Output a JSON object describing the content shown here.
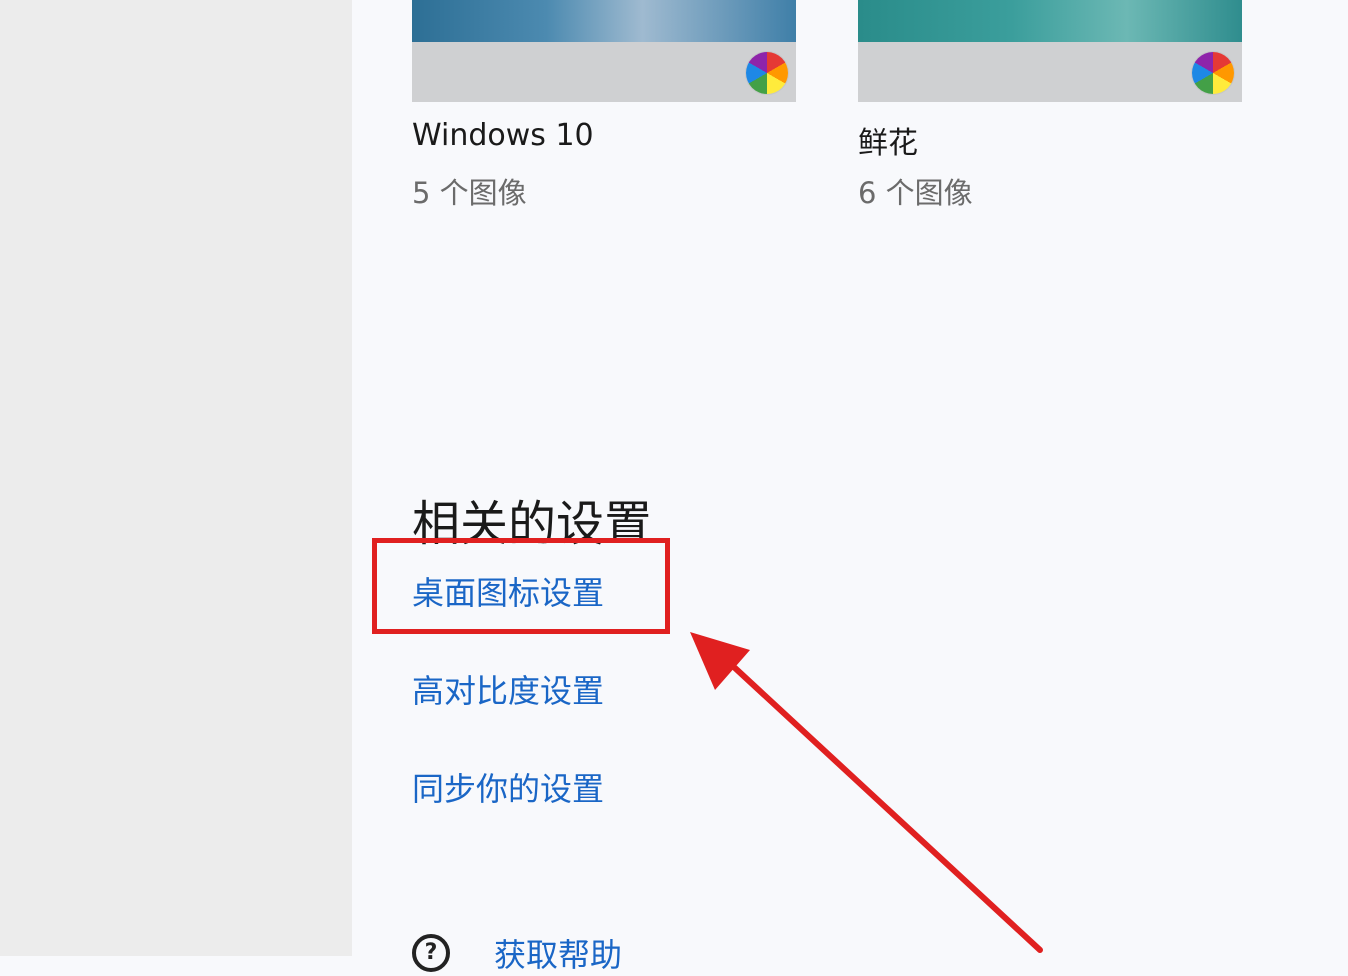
{
  "themes": [
    {
      "title": "Windows 10",
      "subtitle": "5 个图像"
    },
    {
      "title": "鲜花",
      "subtitle": "6 个图像"
    }
  ],
  "related_settings": {
    "title": "相关的设置",
    "links": [
      "桌面图标设置",
      "高对比度设置",
      "同步你的设置"
    ]
  },
  "help": {
    "label": "获取帮助",
    "icon": "help-chat-icon"
  },
  "annotation": {
    "color": "#e02020"
  }
}
